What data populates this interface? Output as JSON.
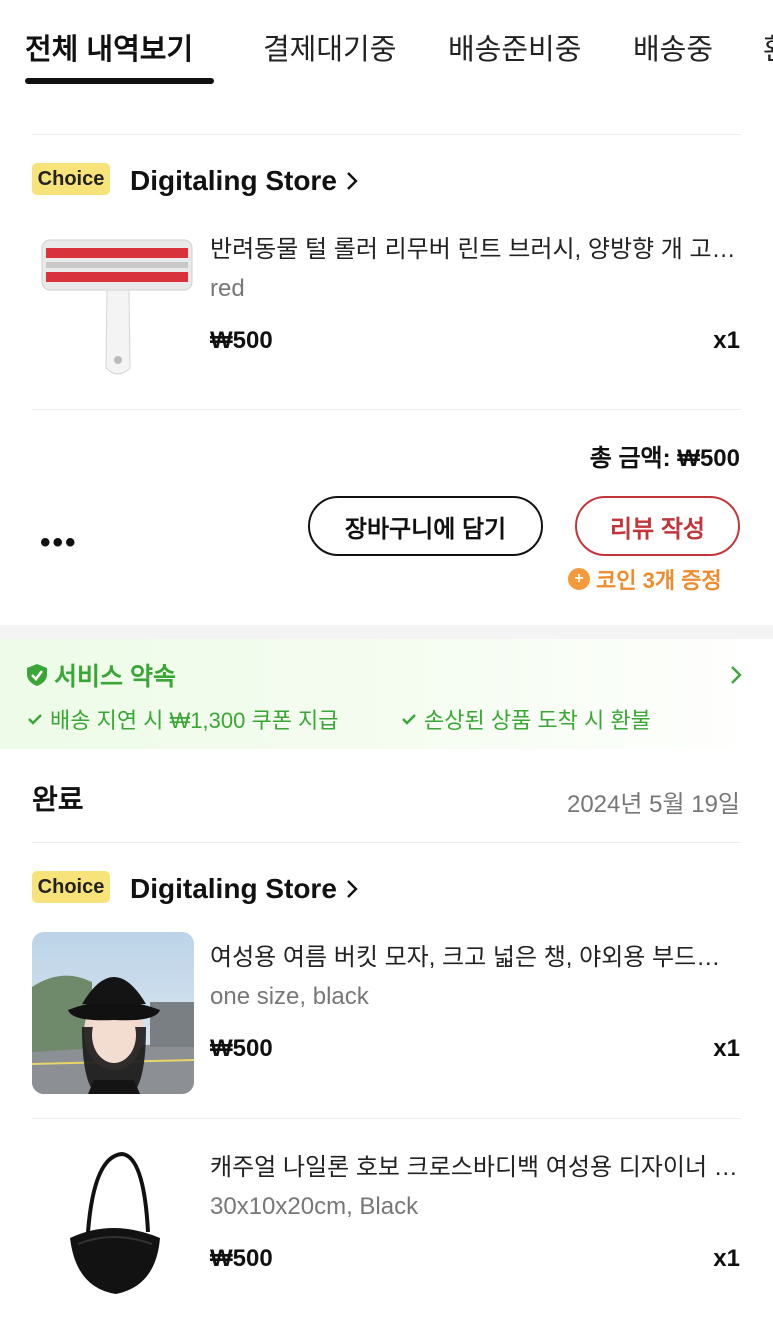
{
  "tabs": [
    "전체 내역보기",
    "결제대기중",
    "배송준비중",
    "배송중",
    "환"
  ],
  "order1": {
    "badge": "Choice",
    "store": "Digitaling Store",
    "item": {
      "title": "반려동물 털 롤러 리무버 린트 브러시, 양방향 개 고양이 털 제거기",
      "variant": "red",
      "price": "₩500",
      "qty": "x1"
    },
    "total": "총 금액: ₩500",
    "more": "•••",
    "cart_button": "장바구니에 담기",
    "review_button": "리뷰 작성",
    "coin_text": "코인 3개 증정"
  },
  "service": {
    "title": "서비스 약속",
    "items": [
      "배송 지연 시 ₩1,300 쿠폰 지급",
      "손상된 상품 도착 시 환불"
    ],
    "accent_color": "#3aa635"
  },
  "order2": {
    "status": "완료",
    "date": "2024년 5월 19일",
    "badge": "Choice",
    "store": "Digitaling Store",
    "items": [
      {
        "title": "여성용 여름 버킷 모자, 크고 넓은 챙, 야외용 부드러운 모자",
        "variant": "one size, black",
        "price": "₩500",
        "qty": "x1"
      },
      {
        "title": "캐주얼 나일론 호보 크로스바디백 여성용 디자이너 숄더백",
        "variant": "30x10x20cm, Black",
        "price": "₩500",
        "qty": "x1"
      }
    ]
  }
}
